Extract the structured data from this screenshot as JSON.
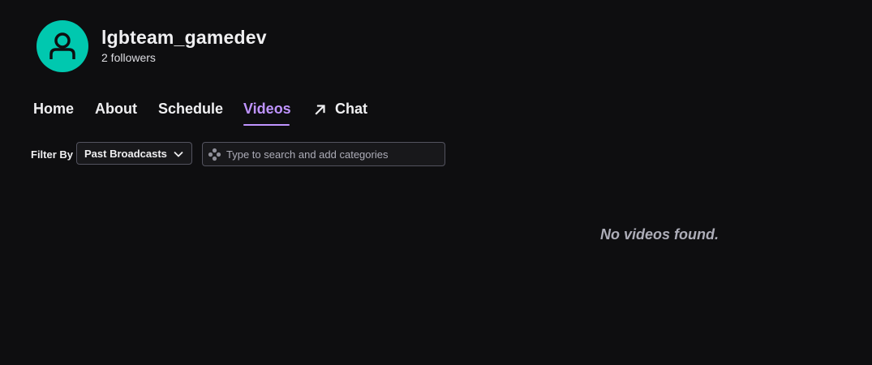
{
  "channel": {
    "name": "lgbteam_gamedev",
    "followers": "2 followers",
    "avatar_color": "#00c8af"
  },
  "nav": {
    "tabs": [
      {
        "label": "Home"
      },
      {
        "label": "About"
      },
      {
        "label": "Schedule"
      },
      {
        "label": "Videos",
        "active": true
      },
      {
        "label": "Chat",
        "icon": "external-link-arrow-icon"
      }
    ]
  },
  "filter": {
    "label": "Filter By",
    "selected": "Past Broadcasts",
    "search_placeholder": "Type to search and add categories",
    "search_icon": "game-controller-icon"
  },
  "empty_state": {
    "message": "No videos found."
  },
  "colors": {
    "background": "#0e0e10",
    "accent": "#bf94ff",
    "text": "#efeff1"
  }
}
